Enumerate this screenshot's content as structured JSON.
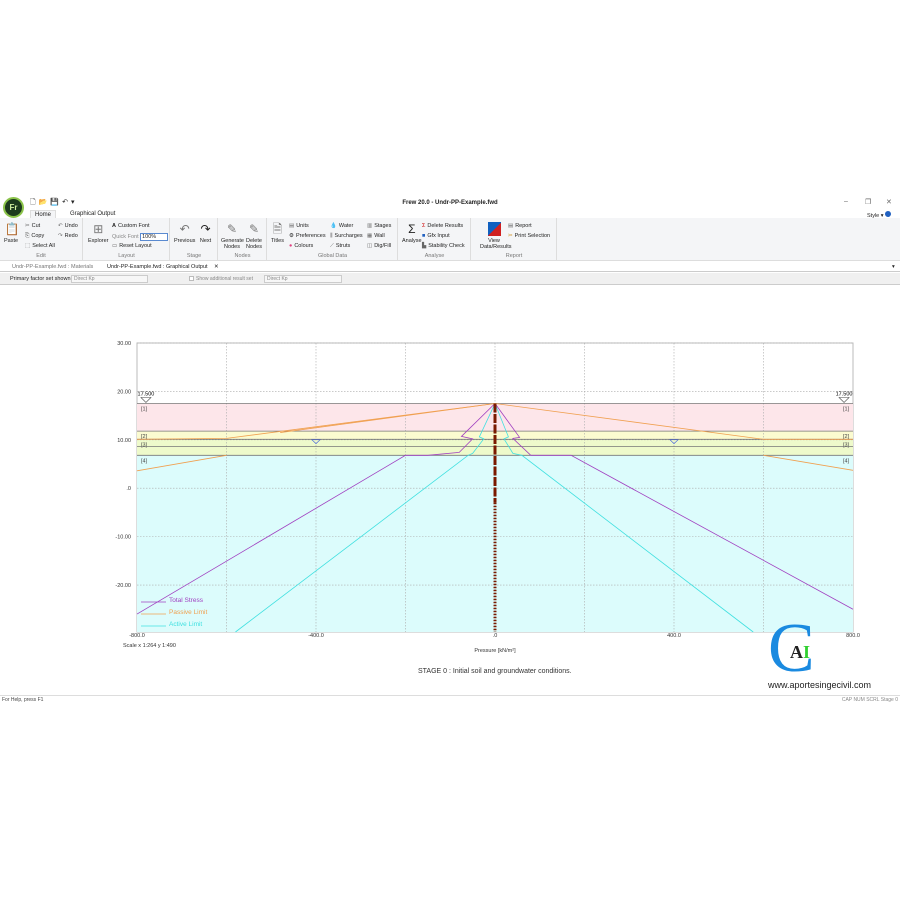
{
  "app": {
    "title": "Frew 20.0 - Undr-PP-Example.fwd",
    "logo": "Fr",
    "style_label": "Style"
  },
  "ribbon_tabs": [
    "Home",
    "Graphical Output"
  ],
  "ribbon": {
    "edit": {
      "label": "Edit",
      "paste": "Paste",
      "cut": "Cut",
      "copy": "Copy",
      "select_all": "Select All",
      "undo": "Undo",
      "redo": "Redo"
    },
    "layout": {
      "label": "Layout",
      "explorer": "Explorer",
      "custom_font": "Custom Font",
      "quick_font": "Quick Font",
      "quick_font_value": "100%",
      "reset_layout": "Reset Layout"
    },
    "stage": {
      "label": "Stage",
      "previous": "Previous",
      "next": "Next"
    },
    "nodes": {
      "label": "Nodes",
      "generate": "Generate Nodes",
      "delete": "Delete Nodes"
    },
    "global": {
      "label": "Global Data",
      "titles": "Titles",
      "units": "Units",
      "preferences": "Preferences",
      "colours": "Colours",
      "water": "Water",
      "surcharges": "Surcharges",
      "struts": "Struts",
      "stages": "Stages",
      "wall": "Wall",
      "digfill": "Dig/Fill"
    },
    "analyse": {
      "label": "Analyse",
      "analyse": "Analyse",
      "delete_results": "Delete Results",
      "gfx_input": "Gfx Input",
      "stability_check": "Stability Check"
    },
    "report": {
      "label": "Report",
      "view": "View Data/Results",
      "report": "Report",
      "print_selection": "Print Selection"
    }
  },
  "doc_tabs": [
    "Undr-PP-Example.fwd : Materials",
    "Undr-PP-Example.fwd : Graphical Output"
  ],
  "options": {
    "primary_label": "Primary factor set shown",
    "primary_value": "Direct Kp",
    "show_additional": "Show additional result set",
    "additional_value": "Direct Kp"
  },
  "chart_data": {
    "type": "line",
    "xlabel": "Pressure [kN/m²]",
    "xlim": [
      -800,
      800
    ],
    "ylim": [
      -29.7,
      30
    ],
    "xticks": [
      {
        "v": -800,
        "l": "-800.0"
      },
      {
        "v": -400,
        "l": "-400.0"
      },
      {
        "v": 0,
        "l": ".0"
      },
      {
        "v": 400,
        "l": "400.0"
      },
      {
        "v": 800,
        "l": "800.0"
      }
    ],
    "xgrid": [
      -600,
      -400,
      -200,
      0,
      200,
      400,
      600
    ],
    "yticks": [
      {
        "v": 30,
        "l": "30.00"
      },
      {
        "v": 20,
        "l": "20.00"
      },
      {
        "v": 10,
        "l": "10.00"
      },
      {
        "v": 0,
        "l": ".0"
      },
      {
        "v": -10,
        "l": "-10.00"
      },
      {
        "v": -20,
        "l": "-20.00"
      }
    ],
    "layers": [
      {
        "name": "[1]",
        "top": 17.5,
        "bottom": 11.8,
        "color": "#fde6ea"
      },
      {
        "name": "[2]",
        "top": 11.8,
        "bottom": 10.1,
        "color": "#fbfbd0"
      },
      {
        "name": "[3]",
        "top": 10.1,
        "bottom": 6.8,
        "color": "#eefacb"
      },
      {
        "name": "[4]",
        "top": 6.8,
        "bottom": -29.7,
        "color": "#dcfcfc"
      }
    ],
    "layer_lines": [
      17.5,
      11.8,
      10.1,
      8.6,
      6.8
    ],
    "ground_level": {
      "value": 17.5,
      "label": "17.500"
    },
    "water_level": 9.6,
    "scale": "Scale x 1:264  y 1:490",
    "series": [
      {
        "name": "Total Stress",
        "color": "#a040c0",
        "segments": [
          [
            [
              0,
              17.5
            ],
            [
              -75,
              10.7
            ],
            [
              -50,
              10.2
            ],
            [
              -80,
              7.4
            ],
            [
              -150,
              6.8
            ],
            [
              -200,
              6.8
            ],
            [
              -800,
              -26
            ]
          ],
          [
            [
              0,
              17.5
            ],
            [
              55,
              10.5
            ],
            [
              40,
              10.3
            ],
            [
              80,
              6.8
            ],
            [
              170,
              6.8
            ],
            [
              800,
              -25
            ]
          ]
        ]
      },
      {
        "name": "Passive Limit",
        "color": "#f0a050",
        "segments": [
          [
            [
              0,
              17.5
            ],
            [
              -600,
              10.3
            ],
            [
              -800,
              10.1
            ]
          ],
          [
            [
              -600,
              6.8
            ],
            [
              -800,
              3.6
            ]
          ],
          [
            [
              0,
              17.5
            ],
            [
              -480,
              11.5
            ]
          ],
          [
            [
              0,
              17.5
            ],
            [
              600,
              10.1
            ],
            [
              800,
              10.1
            ]
          ],
          [
            [
              600,
              6.8
            ],
            [
              800,
              3.7
            ]
          ]
        ]
      },
      {
        "name": "Active Limit",
        "color": "#40e0e0",
        "segments": [
          [
            [
              0,
              17.5
            ],
            [
              -35,
              10.6
            ],
            [
              -25,
              10.2
            ],
            [
              -50,
              7.2
            ],
            [
              -60,
              6.8
            ],
            [
              -580,
              -29.7
            ]
          ],
          [
            [
              0,
              17.5
            ],
            [
              30,
              10.6
            ],
            [
              20,
              10.2
            ],
            [
              40,
              7.2
            ],
            [
              60,
              6.8
            ],
            [
              577,
              -29.7
            ]
          ]
        ]
      }
    ],
    "stage_caption": "STAGE 0 :   Initial soil and groundwater conditions."
  },
  "watermark": {
    "text": "www.aportesingecivil.com",
    "logo": "CAI"
  },
  "status": {
    "left": "For Help, press F1",
    "right": "CAP  NUM  SCRL  Stage 0"
  }
}
